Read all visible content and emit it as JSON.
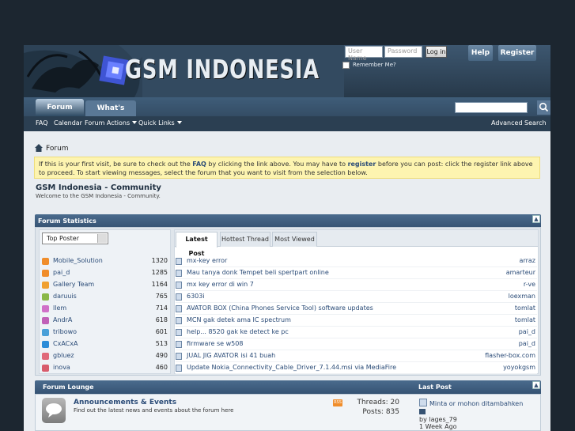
{
  "header": {
    "site_title": "GSM INDONESIA",
    "username_placeholder": "User Name",
    "password_placeholder": "Password",
    "login_label": "Log in",
    "remember_label": "Remember Me?",
    "help_label": "Help",
    "register_label": "Register"
  },
  "nav": {
    "tabs": [
      "Forum",
      "What's New?"
    ],
    "sub_items": [
      "FAQ",
      "Calendar",
      "Forum Actions",
      "Quick Links"
    ],
    "advanced_search": "Advanced Search"
  },
  "breadcrumb": {
    "label": "Forum"
  },
  "notice": {
    "part1": "If this is your first visit, be sure to check out the ",
    "faq": "FAQ",
    "part2": " by clicking the link above. You may have to ",
    "register": "register",
    "part3": " before you can post: click the register link above to proceed. To start viewing messages, select the forum that you want to visit from the selection below."
  },
  "forum": {
    "title": "GSM Indonesia - Community",
    "subtitle": "Welcome to the GSM Indonesia - Community."
  },
  "stats": {
    "heading": "Forum Statistics",
    "dropdown": "Top Poster",
    "posters": [
      {
        "name": "Mobile_Solution",
        "count": "1320",
        "color": "#f08d2b"
      },
      {
        "name": "pai_d",
        "count": "1285",
        "color": "#f08d2b"
      },
      {
        "name": "Gallery Team",
        "count": "1164",
        "color": "#f0a030"
      },
      {
        "name": "daruuis",
        "count": "765",
        "color": "#8ab848"
      },
      {
        "name": "llem",
        "count": "714",
        "color": "#d070c8"
      },
      {
        "name": "AndrA",
        "count": "618",
        "color": "#c060b8"
      },
      {
        "name": "tribowo",
        "count": "601",
        "color": "#4aa0d8"
      },
      {
        "name": "CxACxA",
        "count": "513",
        "color": "#2c8cd8"
      },
      {
        "name": "gbluez",
        "count": "490",
        "color": "#e06a7a"
      },
      {
        "name": "inova",
        "count": "460",
        "color": "#d85c6c"
      }
    ],
    "tabs": [
      "Latest Post",
      "Hottest Thread",
      "Most Viewed"
    ],
    "posts": [
      {
        "title": "mx-key error",
        "user": "arraz"
      },
      {
        "title": "Mau tanya donk Tempet beli spertpart online",
        "user": "amarteur"
      },
      {
        "title": "mx key error di win 7",
        "user": "r-ve"
      },
      {
        "title": "6303i",
        "user": "loexman"
      },
      {
        "title": "AVATOR BOX (China Phones Service Tool) software updates",
        "user": "tomlat"
      },
      {
        "title": "MCN gak detek ama IC spectrum",
        "user": "tomlat"
      },
      {
        "title": "help... 8520 gak ke detect ke pc",
        "user": "pai_d"
      },
      {
        "title": "firmware se w508",
        "user": "pai_d"
      },
      {
        "title": "JUAL JIG AVATOR isi 41 buah",
        "user": "flasher-box.com"
      },
      {
        "title": "Update Nokia_Connectivity_Cable_Driver_7.1.44.msi via MediaFire",
        "user": "yoyokgsm"
      }
    ]
  },
  "lounge": {
    "heading": "Forum Lounge",
    "last_post_heading": "Last Post",
    "forum_title": "Announcements & Events",
    "forum_desc": "Find out the latest news and events about the forum here",
    "threads": "Threads: 20",
    "posts": "Posts: 835",
    "last_post_title": "Minta or mohon ditambahken",
    "last_post_by": "by lages_79",
    "last_post_when": "1 Week Ago"
  },
  "colors": {
    "accent": "#355272",
    "link": "#2a4b77",
    "notice_bg": "#fdf4b0"
  }
}
